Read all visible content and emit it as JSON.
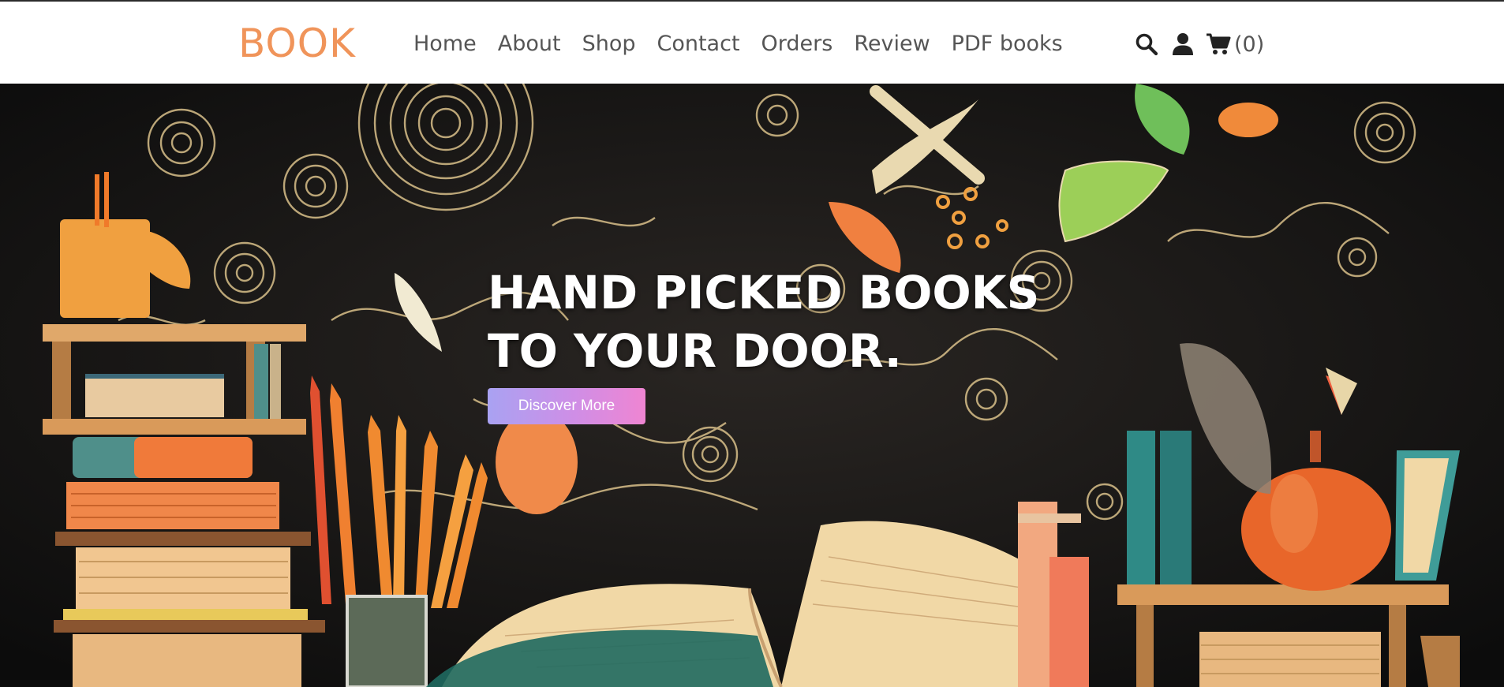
{
  "header": {
    "logo": "BOOK",
    "nav": [
      "Home",
      "About",
      "Shop",
      "Contact",
      "Orders",
      "Review",
      "PDF books"
    ],
    "icons": [
      "search-icon",
      "user-icon",
      "cart-icon"
    ],
    "cart_count": "(0)"
  },
  "hero": {
    "title_line1": "HAND PICKED BOOKS",
    "title_line2": "TO YOUR DOOR.",
    "cta_label": "Discover More"
  },
  "colors": {
    "logo": "#f0945a",
    "nav_text": "#555555",
    "hero_bg": "#141414",
    "button_gradient_start": "#a9a2f2",
    "button_gradient_end": "#ef85d2"
  }
}
